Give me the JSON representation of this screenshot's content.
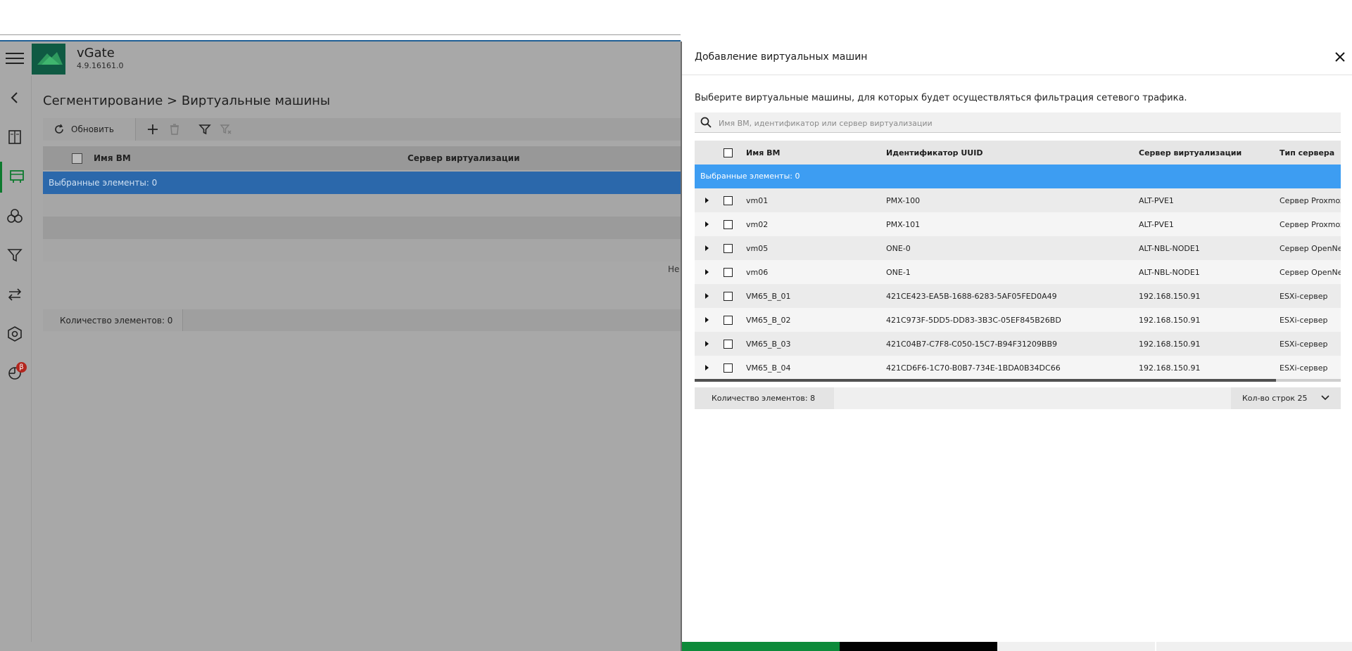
{
  "app": {
    "title": "vGate",
    "version": "4.9.16161.0"
  },
  "rail": {
    "beta_badge": "β"
  },
  "main": {
    "title": "Сегментирование > Виртуальные машины",
    "toolbar": {
      "refresh_label": "Обновить"
    },
    "columns": {
      "name": "Имя ВМ",
      "server": "Сервер виртуализации"
    },
    "selected_text": "Выбранные элементы: 0",
    "empty_text": "Не",
    "count_text": "Количество элементов: 0"
  },
  "drawer": {
    "title": "Добавление виртуальных машин",
    "description": "Выберите виртуальные машины, для которых будет осуществляться фильтрация сетевого трафика.",
    "search_placeholder": "Имя ВМ, идентификатор или сервер виртуализации",
    "columns": {
      "name": "Имя ВМ",
      "uuid": "Идентификатор UUID",
      "server": "Сервер виртуализации",
      "type": "Тип сервера"
    },
    "selected_text": "Выбранные элементы: 0",
    "rows": [
      {
        "name": "vm01",
        "uuid": "PMX-100",
        "server": "ALT-PVE1",
        "type": "Сервер Proxmox"
      },
      {
        "name": "vm02",
        "uuid": "PMX-101",
        "server": "ALT-PVE1",
        "type": "Сервер Proxmox"
      },
      {
        "name": "vm05",
        "uuid": "ONE-0",
        "server": "ALT-NBL-NODE1",
        "type": "Сервер OpenNebula"
      },
      {
        "name": "vm06",
        "uuid": "ONE-1",
        "server": "ALT-NBL-NODE1",
        "type": "Сервер OpenNebula"
      },
      {
        "name": "VM65_B_01",
        "uuid": "421CE423-EA5B-1688-6283-5AF05FED0A49",
        "server": "192.168.150.91",
        "type": "ESXi-сервер"
      },
      {
        "name": "VM65_B_02",
        "uuid": "421C973F-5DD5-DD83-3B3C-05EF845B26BD",
        "server": "192.168.150.91",
        "type": "ESXi-сервер"
      },
      {
        "name": "VM65_B_03",
        "uuid": "421C04B7-C7F8-C050-15C7-B94F31209BB9",
        "server": "192.168.150.91",
        "type": "ESXi-сервер"
      },
      {
        "name": "VM65_B_04",
        "uuid": "421CD6F6-1C70-B0B7-734E-1BDA0B34DC66",
        "server": "192.168.150.91",
        "type": "ESXi-сервер"
      }
    ],
    "count_text": "Количество элементов: 8",
    "rows_per_page_text": "Кол-во строк 25"
  },
  "colors": {
    "accent_blue": "#3d9df2",
    "brand_green": "#0d7a2e",
    "header_blue": "#1f5f94"
  },
  "icons": [
    "menu-icon",
    "back-icon",
    "book-icon",
    "network-icon",
    "segments-icon",
    "filter-icon",
    "transfer-icon",
    "settings-icon",
    "monitor-icon",
    "refresh-icon",
    "plus-icon",
    "trash-icon",
    "filter-clear-icon",
    "search-icon",
    "close-icon",
    "chevron-down-icon"
  ]
}
